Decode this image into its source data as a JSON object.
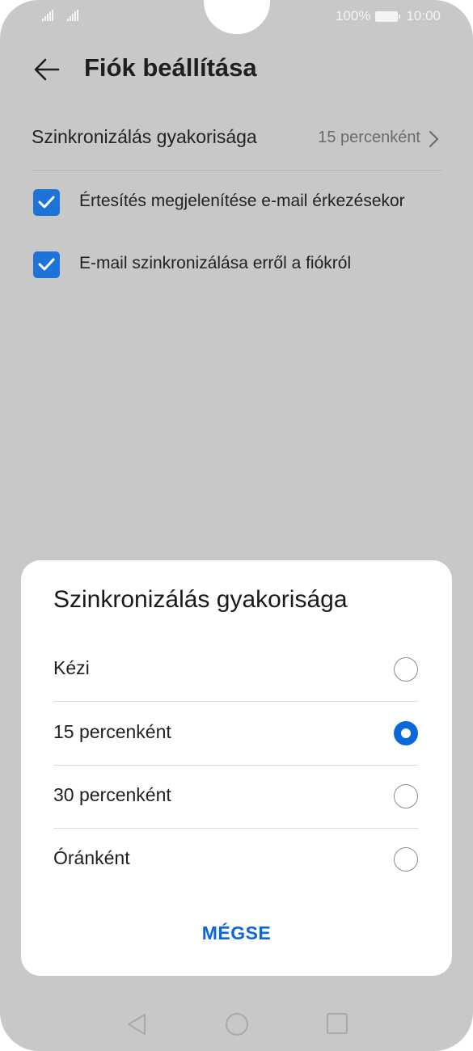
{
  "status_bar": {
    "battery": "100%",
    "time": "10:00"
  },
  "header": {
    "title": "Fiók beállítása"
  },
  "settings": {
    "sync_label": "Szinkronizálás gyakorisága",
    "sync_value": "15 percenként",
    "checkboxes": [
      {
        "label": "Értesítés megjelenítése e-mail érkezésekor",
        "checked": true
      },
      {
        "label": "E-mail szinkronizálása erről a fiókról",
        "checked": true
      }
    ]
  },
  "dialog": {
    "title": "Szinkronizálás gyakorisága",
    "options": [
      {
        "label": "Kézi",
        "selected": false
      },
      {
        "label": "15 percenként",
        "selected": true
      },
      {
        "label": "30 percenként",
        "selected": false
      },
      {
        "label": "Óránként",
        "selected": false
      }
    ],
    "cancel_label": "MÉGSE"
  },
  "colors": {
    "accent": "#0a68dc",
    "checkbox": "#1e73d8",
    "scrim": "#c8c8c8"
  },
  "icons": {
    "back": "arrow-left-icon",
    "chevron": "chevron-right-icon",
    "nav_back": "triangle-back-icon",
    "nav_home": "circle-home-icon",
    "nav_recent": "square-recents-icon"
  }
}
